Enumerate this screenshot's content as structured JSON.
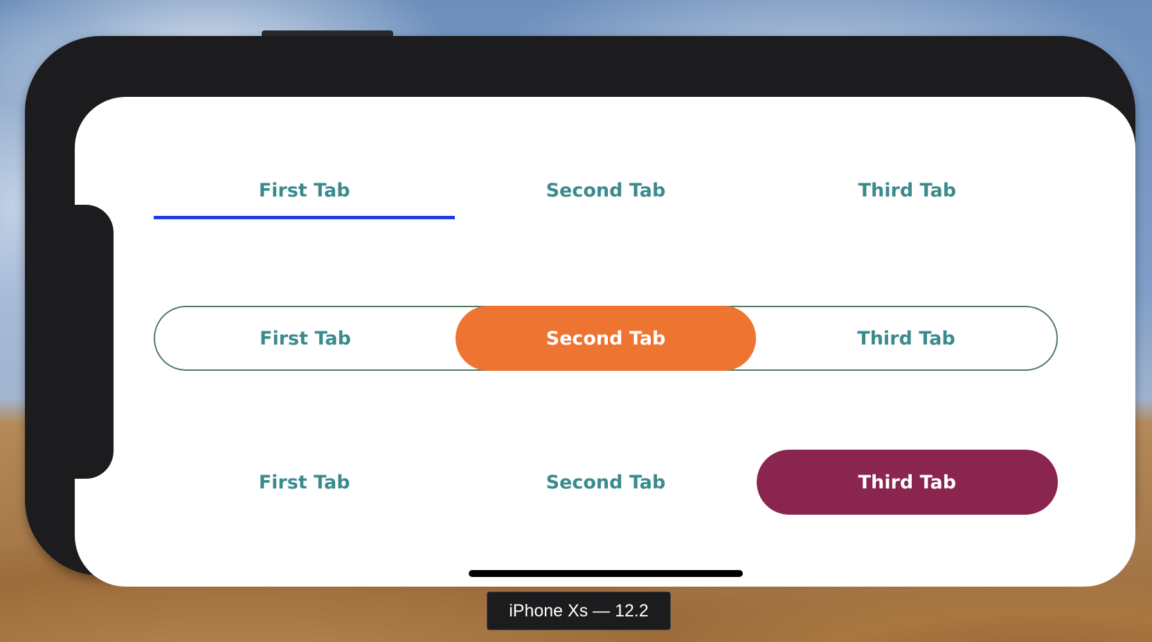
{
  "tab_rows": [
    {
      "style": "underline",
      "selected_index": 0,
      "indicator_color": "#1f3de0",
      "tabs": [
        {
          "label": "First Tab"
        },
        {
          "label": "Second Tab"
        },
        {
          "label": "Third Tab"
        }
      ]
    },
    {
      "style": "outlined-segmented",
      "selected_index": 1,
      "indicator_color": "#ee7432",
      "tabs": [
        {
          "label": "First Tab"
        },
        {
          "label": "Second Tab"
        },
        {
          "label": "Third Tab"
        }
      ]
    },
    {
      "style": "pill",
      "selected_index": 2,
      "indicator_color": "#8a2550",
      "tabs": [
        {
          "label": "First Tab"
        },
        {
          "label": "Second Tab"
        },
        {
          "label": "Third Tab"
        }
      ]
    }
  ],
  "colors": {
    "tab_text": "#3b8a8c",
    "active_text": "#ffffff",
    "outline_border": "#4f7a5e",
    "phone_frame": "#1c1c1e",
    "screen_background": "#ffffff"
  },
  "simulator_label": "iPhone Xs — 12.2"
}
